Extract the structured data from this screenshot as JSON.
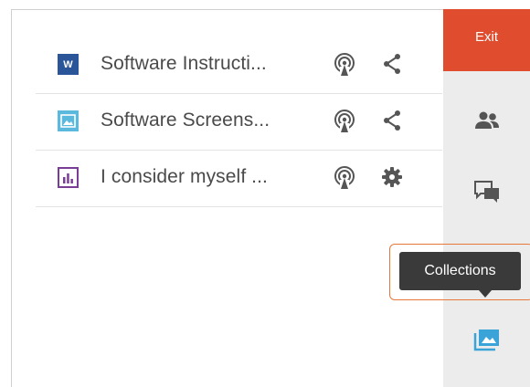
{
  "files": [
    {
      "name": "Software Instructi...",
      "type_icon": "word-document-icon",
      "type_letter": "W",
      "action_icon": "share-icon"
    },
    {
      "name": "Software Screens...",
      "type_icon": "image-file-icon",
      "action_icon": "share-icon"
    },
    {
      "name": "I consider myself ...",
      "type_icon": "survey-chart-icon",
      "action_icon": "gear-icon"
    }
  ],
  "rail": {
    "exit_label": "Exit",
    "items": [
      {
        "icon": "people-icon"
      },
      {
        "icon": "chat-icon"
      },
      {
        "icon": "collections-icon"
      }
    ]
  },
  "tooltip": {
    "label": "Collections"
  },
  "colors": {
    "exit_bg": "#e04c2e",
    "rail_bg": "#ececec",
    "accent_blue": "#3aa3d8",
    "tooltip_bg": "#3a3a3a",
    "highlight_border": "#e6793a"
  }
}
